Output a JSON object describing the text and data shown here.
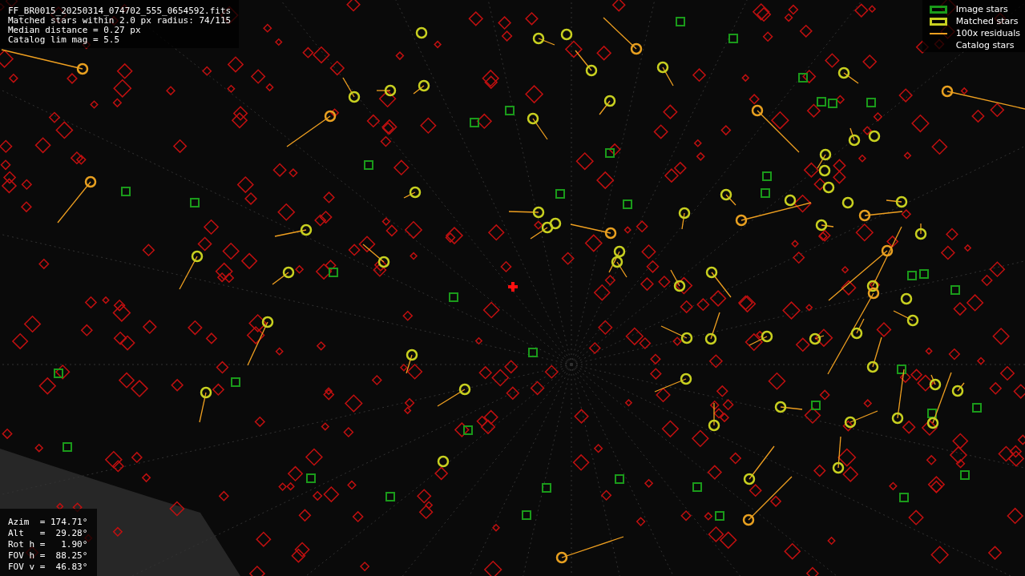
{
  "header": {
    "lines": [
      "FF_BR0015_20250314_074702_555_0654592.fits",
      "Matched stars within 2.0 px radius: 74/115",
      "Median distance = 0.27 px",
      "Catalog lim mag = 5.5"
    ]
  },
  "legend": [
    {
      "kind": "image",
      "label": "Image stars"
    },
    {
      "kind": "matched",
      "label": "Matched stars"
    },
    {
      "kind": "residual",
      "label": "100x residuals"
    },
    {
      "kind": "catalog",
      "label": "Catalog stars"
    }
  ],
  "pointing": {
    "lines": [
      "Azim  = 174.71°",
      "Alt   =  29.28°",
      "Rot h =   1.90°",
      "FOV h =  88.25°",
      "FOV v =  46.83°"
    ]
  }
}
